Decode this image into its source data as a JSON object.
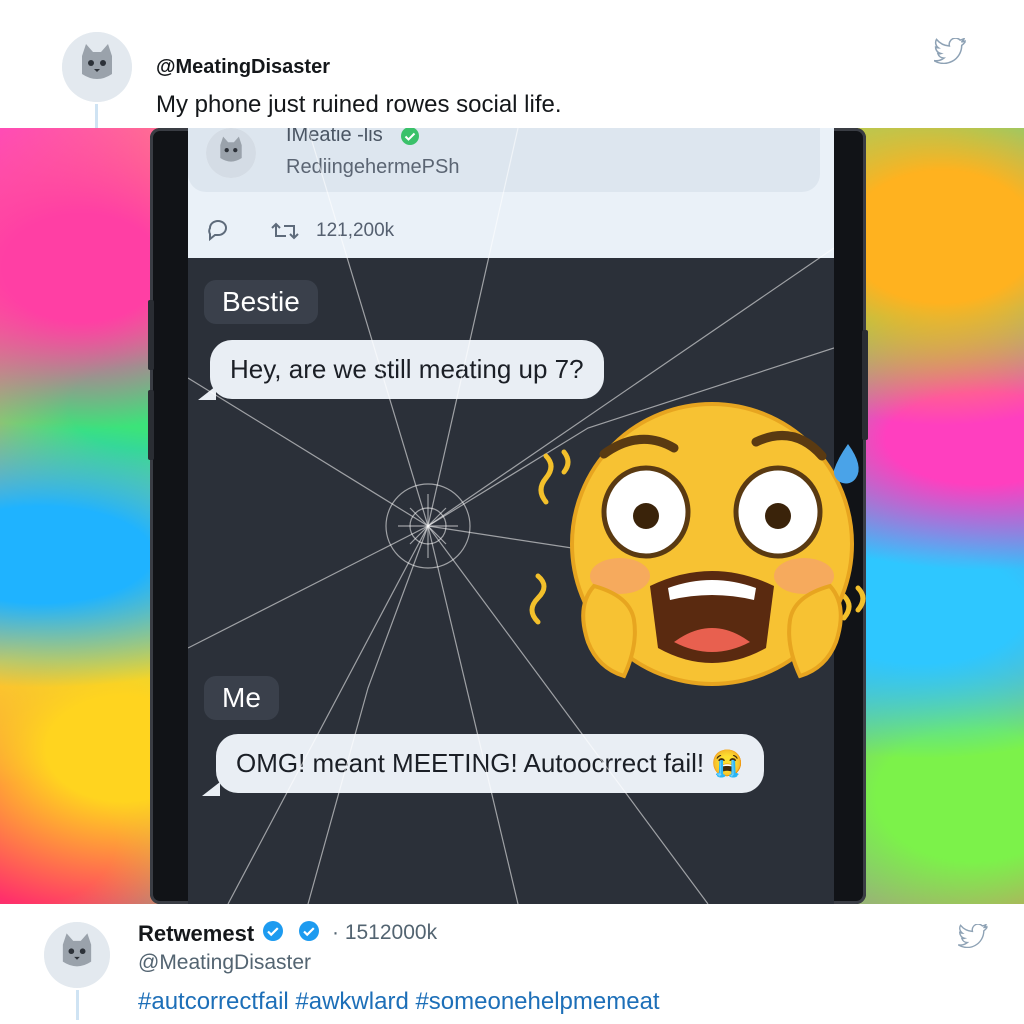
{
  "tweet": {
    "handle": "@MeatingDisaster",
    "text": "My phone just ruined rowes social life."
  },
  "screen": {
    "inner_tweet": {
      "name": "IMeatie -lis",
      "subtitle": "RediingehermePSh",
      "retweet_count": "121,200k"
    },
    "chat": {
      "sender_label": "Bestie",
      "incoming_message": "Hey, are we still meating up 7?",
      "me_label": "Me",
      "outgoing_message": "OMG! meant MEETING! Autoocrrect fail! 😭"
    }
  },
  "footer": {
    "retweeter_name": "Retwemest",
    "count": "· 1512000k",
    "handle": "@MeatingDisaster",
    "hashtags": "#autcorrectfail #awkwlard #someonehelpmemeat"
  },
  "icons": {
    "avatar": "cat-avatar-icon",
    "bird": "twitter-bird-icon",
    "verified": "verified-badge-icon",
    "reply": "reply-icon",
    "retweet": "retweet-icon",
    "emoji": "screaming-face-emoji-icon"
  },
  "colors": {
    "accent": "#1d9bf0",
    "hashtag": "#1d6fb8",
    "screen_bg": "#2b3039"
  }
}
